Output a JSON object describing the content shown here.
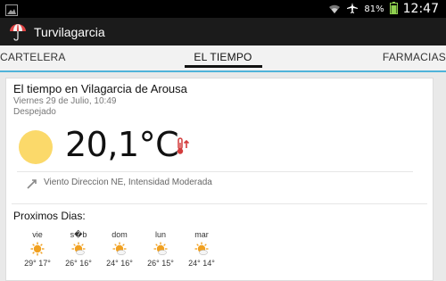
{
  "statusbar": {
    "wifi_icon": "wifi-icon",
    "airplane_icon": "airplane-icon",
    "battery_percent": "81%",
    "time": "12:47"
  },
  "app": {
    "title": "Turvilagarcia",
    "icon": "umbrella-icon"
  },
  "tabs": [
    {
      "label": "CARTELERA"
    },
    {
      "label": "EL TIEMPO",
      "selected": true
    },
    {
      "label": "FARMACIAS"
    }
  ],
  "weather": {
    "place": "El tiempo en Vilagarcia de Arousa",
    "date": "Viernes 29 de Julio, 10:49",
    "condition": "Despejado",
    "temperature": "20,1°C",
    "wind": "Viento Direccion NE, Intensidad Moderada"
  },
  "forecast": {
    "title": "Proximos Dias:",
    "days": [
      {
        "name": "vie",
        "temps": "29° 17°",
        "icon": "sun-icon"
      },
      {
        "name": "s�b",
        "temps": "26° 16°",
        "icon": "sun-cloud-icon"
      },
      {
        "name": "dom",
        "temps": "24° 16°",
        "icon": "sun-cloud-icon"
      },
      {
        "name": "lun",
        "temps": "26° 15°",
        "icon": "sun-cloud-icon"
      },
      {
        "name": "mar",
        "temps": "24° 14°",
        "icon": "sun-cloud-icon"
      }
    ]
  },
  "colors": {
    "accent": "#4fb3d9",
    "sun": "#fbd96a",
    "thermometer": "#d33c3c"
  }
}
